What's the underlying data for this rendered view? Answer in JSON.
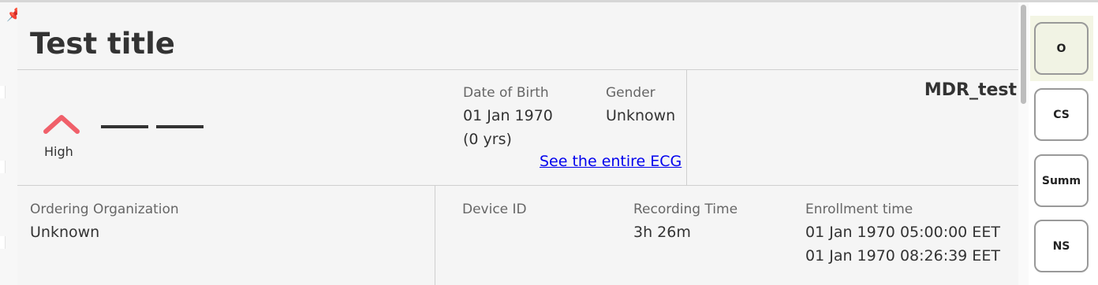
{
  "card": {
    "title": "Test title",
    "trend": {
      "icon": "chevron-up-icon",
      "label": "High"
    },
    "date_of_birth": {
      "label": "Date of Birth",
      "value": "01 Jan 1970",
      "age": "(0 yrs)"
    },
    "gender": {
      "label": "Gender",
      "value": "Unknown"
    },
    "ecg_link": "See the entire ECG",
    "patient_name": "MDR_test",
    "ordering_organization": {
      "label": "Ordering Organization",
      "value": "Unknown"
    },
    "device_id": {
      "label": "Device ID",
      "value": ""
    },
    "recording_time": {
      "label": "Recording Time",
      "value": "3h 26m"
    },
    "enrollment_time": {
      "label": "Enrollment time",
      "start": "01 Jan 1970 05:00:00 EET",
      "end": "01 Jan 1970 08:26:39 EET"
    }
  },
  "side_nav": {
    "buttons": [
      {
        "label": "O",
        "active": true
      },
      {
        "label": "CS",
        "active": false
      },
      {
        "label": "Summ",
        "active": false
      },
      {
        "label": "NS",
        "active": false
      }
    ]
  },
  "colors": {
    "accent_high": "#f0606a",
    "link": "#0000ee",
    "active_button_bg": "#f1f3e4"
  }
}
